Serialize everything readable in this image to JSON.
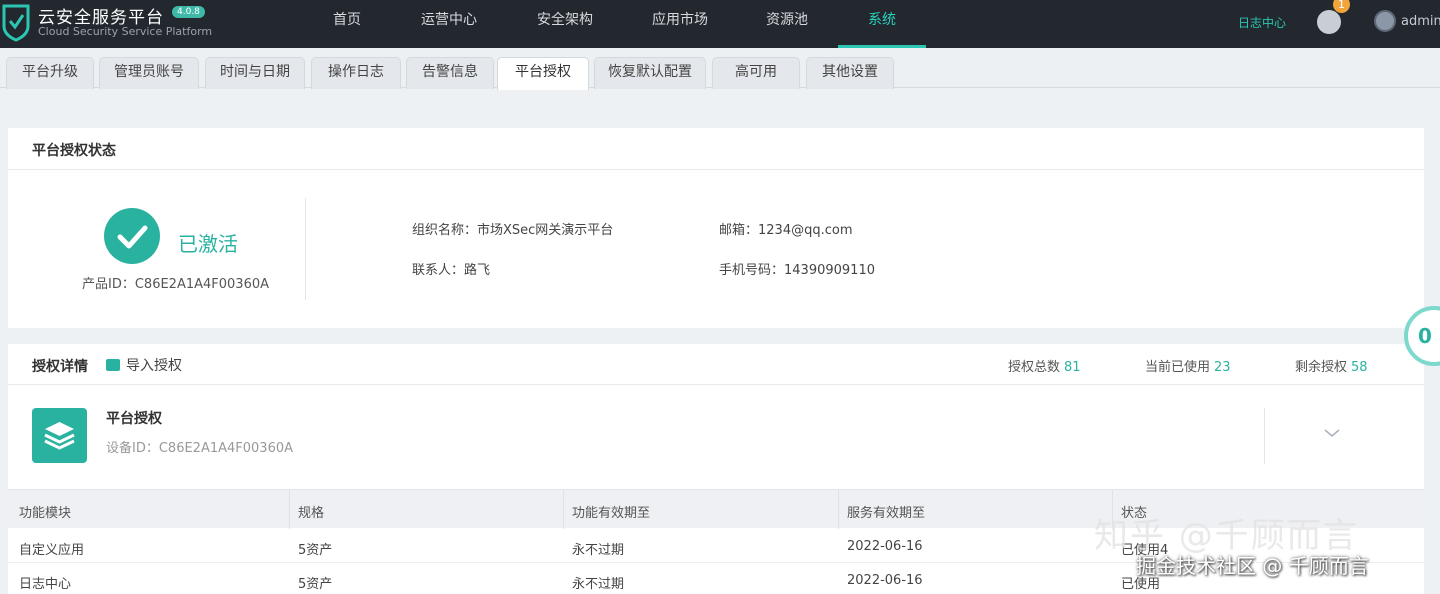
{
  "header": {
    "brand": "云安全服务平台",
    "brand_badge": "4.0.8",
    "brand_sub": "Cloud Security Service Platform",
    "nav": [
      "首页",
      "运营中心",
      "安全架构",
      "应用市场",
      "资源池",
      "系统"
    ],
    "active_nav": "系统",
    "log_center": "日志中心",
    "notification_count": "1",
    "username": "admin",
    "accent_color": "#2bc7b2"
  },
  "tabs": {
    "items": [
      "平台升级",
      "管理员账号",
      "时间与日期",
      "操作日志",
      "告警信息",
      "平台授权",
      "恢复默认配置",
      "高可用",
      "其他设置"
    ],
    "active": "平台授权"
  },
  "status": {
    "title": "平台授权状态",
    "state": "已激活",
    "product_id": "产品ID：C86E2A1A4F00360A",
    "org": "组织名称：市场XSec网关演示平台",
    "contact": "联系人：路飞",
    "email": "邮箱：1234@qq.com",
    "phone": "手机号码：14390909110"
  },
  "details": {
    "title": "授权详情",
    "import_label": "导入授权",
    "total_label": "授权总数",
    "total": "81",
    "used_label": "当前已使用",
    "used": "23",
    "remaining_label": "剩余授权",
    "remaining": "58",
    "license_title": "平台授权",
    "device_id": "设备ID：C86E2A1A4F00360A",
    "columns": [
      "功能模块",
      "规格",
      "功能有效期至",
      "服务有效期至",
      "状态"
    ],
    "rows": [
      [
        "自定义应用",
        "5资产",
        "永不过期",
        "2022-06-16",
        "已使用4"
      ],
      [
        "日志中心",
        "5资产",
        "永不过期",
        "2022-06-16",
        "已使用"
      ]
    ]
  },
  "floating_counter": "0",
  "watermark": {
    "line1": "知乎 @千顾而言",
    "line2": "掘金技术社区 @ 千顾而言"
  }
}
